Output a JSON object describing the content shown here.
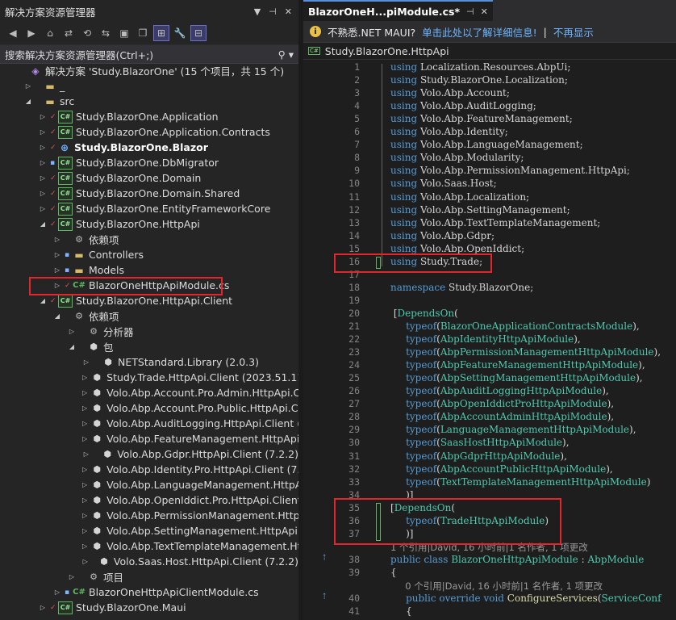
{
  "solution_explorer": {
    "title": "解决方案资源管理器",
    "search_placeholder": "搜索解决方案资源管理器(Ctrl+;)",
    "tree": [
      {
        "indent": 0,
        "arrow": "",
        "kind": "sln",
        "label": "解决方案 'Study.BlazorOne' (15 个项目，共 15 个)"
      },
      {
        "indent": 1,
        "arrow": "▷",
        "kind": "folder",
        "label": "_"
      },
      {
        "indent": 1,
        "arrow": "◢",
        "kind": "folder",
        "label": "src"
      },
      {
        "indent": 2,
        "arrow": "▷",
        "mark": "✓",
        "kind": "cs",
        "label": "Study.BlazorOne.Application"
      },
      {
        "indent": 2,
        "arrow": "▷",
        "mark": "✓",
        "kind": "cs",
        "label": "Study.BlazorOne.Application.Contracts"
      },
      {
        "indent": 2,
        "arrow": "▷",
        "mark": "✓",
        "kind": "web",
        "label": "Study.BlazorOne.Blazor",
        "bold": true
      },
      {
        "indent": 2,
        "arrow": "▷",
        "mark": "🔒",
        "kind": "cs",
        "label": "Study.BlazorOne.DbMigrator"
      },
      {
        "indent": 2,
        "arrow": "▷",
        "mark": "✓",
        "kind": "cs",
        "label": "Study.BlazorOne.Domain"
      },
      {
        "indent": 2,
        "arrow": "▷",
        "mark": "✓",
        "kind": "cs",
        "label": "Study.BlazorOne.Domain.Shared"
      },
      {
        "indent": 2,
        "arrow": "▷",
        "mark": "✓",
        "kind": "cs",
        "label": "Study.BlazorOne.EntityFrameworkCore"
      },
      {
        "indent": 2,
        "arrow": "◢",
        "mark": "✓",
        "kind": "cs",
        "label": "Study.BlazorOne.HttpApi"
      },
      {
        "indent": 3,
        "arrow": "▷",
        "kind": "dep",
        "label": "依赖项"
      },
      {
        "indent": 3,
        "arrow": "▷",
        "mark": "🔒",
        "kind": "folder",
        "label": "Controllers"
      },
      {
        "indent": 3,
        "arrow": "▷",
        "mark": "🔒",
        "kind": "folder",
        "label": "Models"
      },
      {
        "indent": 3,
        "arrow": "▷",
        "mark": "✓",
        "kind": "file",
        "label": "BlazorOneHttpApiModule.cs"
      },
      {
        "indent": 2,
        "arrow": "◢",
        "mark": "✓",
        "kind": "cs",
        "label": "Study.BlazorOne.HttpApi.Client"
      },
      {
        "indent": 3,
        "arrow": "◢",
        "kind": "dep",
        "label": "依赖项"
      },
      {
        "indent": 4,
        "arrow": "▷",
        "kind": "dep",
        "label": "分析器"
      },
      {
        "indent": 4,
        "arrow": "◢",
        "kind": "pkg",
        "label": "包"
      },
      {
        "indent": 5,
        "arrow": "▷",
        "kind": "pkg",
        "label": "NETStandard.Library (2.0.3)"
      },
      {
        "indent": 5,
        "arrow": "▷",
        "kind": "pkg",
        "label": "Study.Trade.HttpApi.Client (2023.51.11)"
      },
      {
        "indent": 5,
        "arrow": "▷",
        "kind": "pkg",
        "label": "Volo.Abp.Account.Pro.Admin.HttpApi.Clier"
      },
      {
        "indent": 5,
        "arrow": "▷",
        "kind": "pkg",
        "label": "Volo.Abp.Account.Pro.Public.HttpApi.Clier"
      },
      {
        "indent": 5,
        "arrow": "▷",
        "kind": "pkg",
        "label": "Volo.Abp.AuditLogging.HttpApi.Client (7.2"
      },
      {
        "indent": 5,
        "arrow": "▷",
        "kind": "pkg",
        "label": "Volo.Abp.FeatureManagement.HttpApi.Cli"
      },
      {
        "indent": 5,
        "arrow": "▷",
        "kind": "pkg",
        "label": "Volo.Abp.Gdpr.HttpApi.Client (7.2.2)"
      },
      {
        "indent": 5,
        "arrow": "▷",
        "kind": "pkg",
        "label": "Volo.Abp.Identity.Pro.HttpApi.Client (7.2.2"
      },
      {
        "indent": 5,
        "arrow": "▷",
        "kind": "pkg",
        "label": "Volo.Abp.LanguageManagement.HttpApi."
      },
      {
        "indent": 5,
        "arrow": "▷",
        "kind": "pkg",
        "label": "Volo.Abp.OpenIddict.Pro.HttpApi.Client (7"
      },
      {
        "indent": 5,
        "arrow": "▷",
        "kind": "pkg",
        "label": "Volo.Abp.PermissionManagement.HttpAp"
      },
      {
        "indent": 5,
        "arrow": "▷",
        "kind": "pkg",
        "label": "Volo.Abp.SettingManagement.HttpApi.Cli"
      },
      {
        "indent": 5,
        "arrow": "▷",
        "kind": "pkg",
        "label": "Volo.Abp.TextTemplateManagement.Http."
      },
      {
        "indent": 5,
        "arrow": "▷",
        "kind": "pkg",
        "label": "Volo.Saas.Host.HttpApi.Client (7.2.2)"
      },
      {
        "indent": 4,
        "arrow": "▷",
        "kind": "dep",
        "label": "项目"
      },
      {
        "indent": 3,
        "arrow": "▷",
        "mark": "🔒",
        "kind": "file",
        "label": "BlazorOneHttpApiClientModule.cs"
      },
      {
        "indent": 2,
        "arrow": "▷",
        "mark": "✓",
        "kind": "cs",
        "label": "Study.BlazorOne.Maui"
      }
    ]
  },
  "editor": {
    "tab_label": "BlazorOneH...piModule.cs*",
    "tab_pin": "⊣",
    "tab_close": "✕",
    "info_text": "不熟悉.NET MAUI?",
    "info_link": "单击此处以了解详细信息!",
    "info_sep": "|",
    "info_dismiss": "不再显示",
    "namespace_bar": "Study.BlazorOne.HttpApi",
    "lines": [
      {
        "n": "1",
        "t": "using Localization.Resources.AbpUi;"
      },
      {
        "n": "2",
        "t": "using Study.BlazorOne.Localization;"
      },
      {
        "n": "3",
        "t": "using Volo.Abp.Account;"
      },
      {
        "n": "4",
        "t": "using Volo.Abp.AuditLogging;"
      },
      {
        "n": "5",
        "t": "using Volo.Abp.FeatureManagement;"
      },
      {
        "n": "6",
        "t": "using Volo.Abp.Identity;"
      },
      {
        "n": "7",
        "t": "using Volo.Abp.LanguageManagement;"
      },
      {
        "n": "8",
        "t": "using Volo.Abp.Modularity;"
      },
      {
        "n": "9",
        "t": "using Volo.Abp.PermissionManagement.HttpApi;"
      },
      {
        "n": "10",
        "t": "using Volo.Saas.Host;"
      },
      {
        "n": "11",
        "t": "using Volo.Abp.Localization;"
      },
      {
        "n": "12",
        "t": "using Volo.Abp.SettingManagement;"
      },
      {
        "n": "13",
        "t": "using Volo.Abp.TextTemplateManagement;"
      },
      {
        "n": "14",
        "t": "using Volo.Abp.Gdpr;"
      },
      {
        "n": "15",
        "t": "using Volo.Abp.OpenIddict;"
      },
      {
        "n": "16",
        "t": "using Study.Trade;"
      },
      {
        "n": "17",
        "t": ""
      },
      {
        "n": "18",
        "t": "namespace Study.BlazorOne;"
      },
      {
        "n": "19",
        "t": ""
      },
      {
        "n": "20",
        "t": " [DependsOn("
      },
      {
        "n": "21",
        "t": "     typeof(BlazorOneApplicationContractsModule),"
      },
      {
        "n": "22",
        "t": "     typeof(AbpIdentityHttpApiModule),"
      },
      {
        "n": "23",
        "t": "     typeof(AbpPermissionManagementHttpApiModule),"
      },
      {
        "n": "24",
        "t": "     typeof(AbpFeatureManagementHttpApiModule),"
      },
      {
        "n": "25",
        "t": "     typeof(AbpSettingManagementHttpApiModule),"
      },
      {
        "n": "26",
        "t": "     typeof(AbpAuditLoggingHttpApiModule),"
      },
      {
        "n": "27",
        "t": "     typeof(AbpOpenIddictProHttpApiModule),"
      },
      {
        "n": "28",
        "t": "     typeof(AbpAccountAdminHttpApiModule),"
      },
      {
        "n": "29",
        "t": "     typeof(LanguageManagementHttpApiModule),"
      },
      {
        "n": "30",
        "t": "     typeof(SaasHostHttpApiModule),"
      },
      {
        "n": "31",
        "t": "     typeof(AbpGdprHttpApiModule),"
      },
      {
        "n": "32",
        "t": "     typeof(AbpAccountPublicHttpApiModule),"
      },
      {
        "n": "33",
        "t": "     typeof(TextTemplateManagementHttpApiModule)"
      },
      {
        "n": "34",
        "t": "     )]"
      },
      {
        "n": "35",
        "t": "[DependsOn("
      },
      {
        "n": "36",
        "t": "     typeof(TradeHttpApiModule)"
      },
      {
        "n": "37",
        "t": "     )]"
      },
      {
        "n": "",
        "lens": "1 个引用|David, 16 小时前|1 名作者, 1 项更改"
      },
      {
        "n": "38",
        "t": "public class BlazorOneHttpApiModule : AbpModule"
      },
      {
        "n": "39",
        "t": "{"
      },
      {
        "n": "",
        "lens": "     0 个引用|David, 16 小时前|1 名作者, 1 项更改"
      },
      {
        "n": "40",
        "t": "     public override void ConfigureServices(ServiceConf"
      },
      {
        "n": "41",
        "t": "     {"
      }
    ]
  }
}
